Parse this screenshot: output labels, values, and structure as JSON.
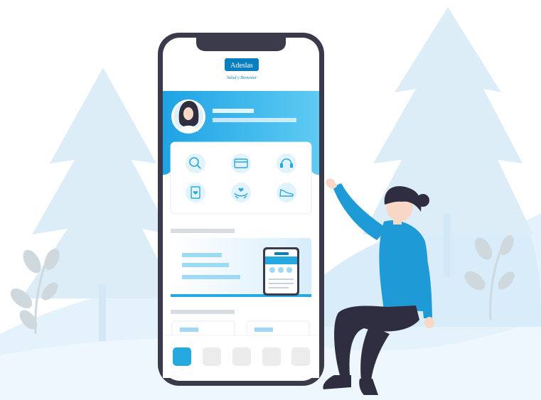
{
  "brand": {
    "name": "Adeslas",
    "tagline": "Salud y Bienestar"
  },
  "colors": {
    "brand_blue": "#0a7fbf",
    "primary_blue": "#25a9e0",
    "banner_gradient_start": "#1ea3e4",
    "banner_gradient_end": "#5ecbf3",
    "phone_frame": "#3a3a4a",
    "scene_light_blue": "#dff0fa",
    "person_shirt": "#1e9ad6",
    "person_pants": "#2f2e41"
  },
  "phone": {
    "quick_actions": [
      {
        "icon": "search-icon"
      },
      {
        "icon": "card-icon"
      },
      {
        "icon": "headset-icon"
      },
      {
        "icon": "health-document-icon"
      },
      {
        "icon": "hands-heart-icon"
      },
      {
        "icon": "sneaker-icon"
      }
    ],
    "bottom_nav": [
      {
        "icon": "nav-tab-1",
        "active": true
      },
      {
        "icon": "nav-tab-2",
        "active": false
      },
      {
        "icon": "nav-tab-3",
        "active": false
      },
      {
        "icon": "nav-tab-4",
        "active": false
      },
      {
        "icon": "nav-tab-5",
        "active": false
      }
    ]
  }
}
